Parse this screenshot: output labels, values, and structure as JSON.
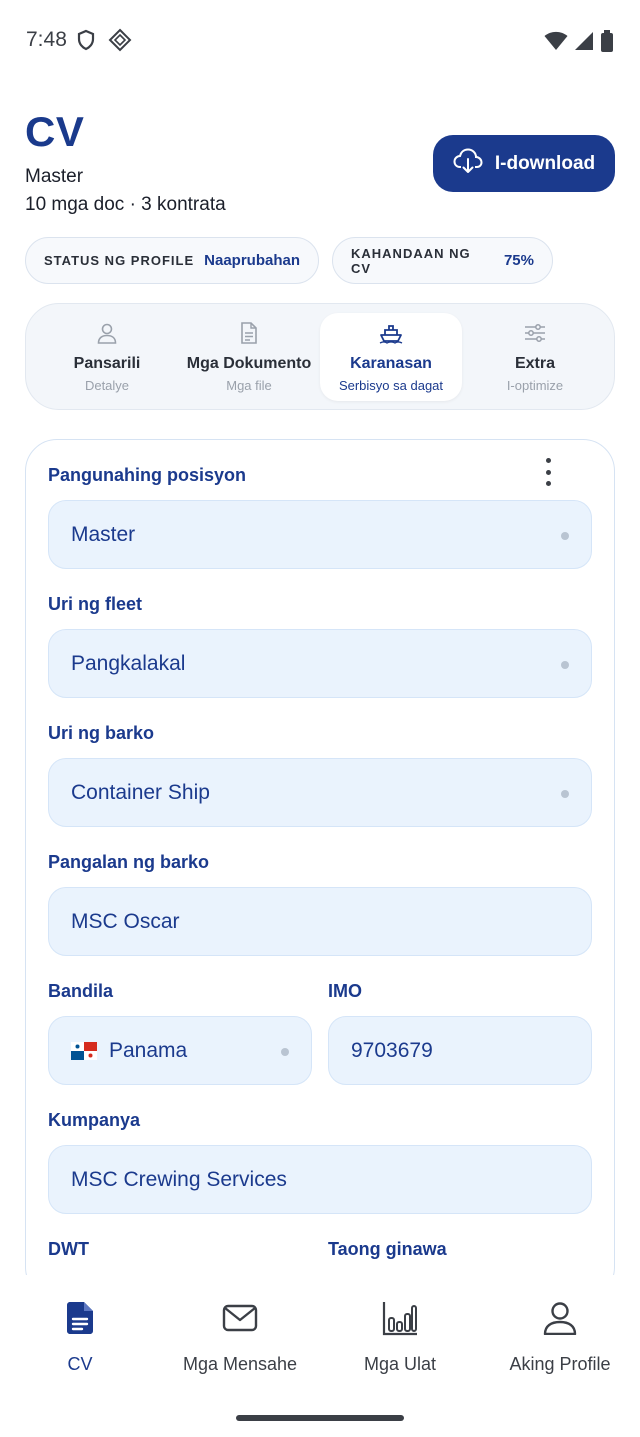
{
  "status_bar": {
    "time": "7:48"
  },
  "header": {
    "title": "CV",
    "position": "Master",
    "meta": "10 mga doc · 3 kontrata",
    "download_label": "I-download"
  },
  "badges": [
    {
      "label": "STATUS NG PROFILE",
      "value": "Naaprubahan"
    },
    {
      "label": "KAHANDAAN NG CV",
      "value": "75%"
    }
  ],
  "tabs": [
    {
      "label": "Pansarili",
      "sub": "Detalye",
      "icon": "person-icon"
    },
    {
      "label": "Mga Dokumento",
      "sub": "Mga file",
      "icon": "document-icon"
    },
    {
      "label": "Karanasan",
      "sub": "Serbisyo sa dagat",
      "icon": "ship-icon"
    },
    {
      "label": "Extra",
      "sub": "I-optimize",
      "icon": "sliders-icon"
    }
  ],
  "form": {
    "primary_position": {
      "label": "Pangunahing posisyon",
      "value": "Master"
    },
    "fleet_type": {
      "label": "Uri ng fleet",
      "value": "Pangkalakal"
    },
    "vessel_type": {
      "label": "Uri ng barko",
      "value": "Container Ship"
    },
    "vessel_name": {
      "label": "Pangalan ng barko",
      "value": "MSC Oscar"
    },
    "flag": {
      "label": "Bandila",
      "value": "Panama"
    },
    "imo": {
      "label": "IMO",
      "value": "9703679"
    },
    "company": {
      "label": "Kumpanya",
      "value": "MSC Crewing Services"
    },
    "dwt": {
      "label": "DWT",
      "value": ""
    },
    "year_built": {
      "label": "Taong ginawa",
      "value": ""
    }
  },
  "bottom_nav": [
    {
      "label": "CV",
      "icon": "cv-document-icon"
    },
    {
      "label": "Mga Mensahe",
      "icon": "mail-icon"
    },
    {
      "label": "Mga Ulat",
      "icon": "bar-chart-icon"
    },
    {
      "label": "Aking Profile",
      "icon": "profile-icon"
    }
  ],
  "colors": {
    "accent": "#1b3a8d",
    "field_bg": "#eaf3fd"
  }
}
